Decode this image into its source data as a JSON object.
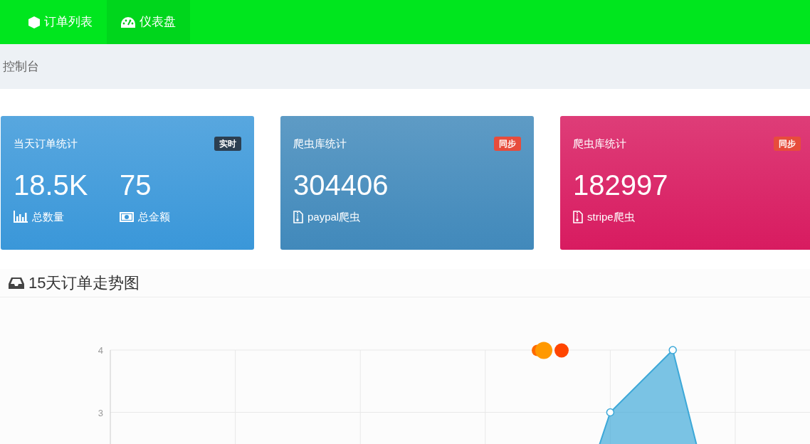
{
  "navbar": {
    "items": [
      {
        "label": "订单列表",
        "kind": "cube",
        "selected": false
      },
      {
        "label": "仪表盘",
        "kind": "gauge",
        "selected": true
      }
    ]
  },
  "breadcrumb": "控制台",
  "cards": [
    {
      "title": "当天订单统计",
      "badge": {
        "text": "实时",
        "color": "#2c3e50"
      },
      "color": "#3a97d9",
      "stats": [
        {
          "value": "18.5K",
          "label": "总数量",
          "kind": "bars"
        },
        {
          "value": "75",
          "label": "总金额",
          "kind": "money"
        }
      ]
    },
    {
      "title": "爬虫库统计",
      "badge": {
        "text": "同步",
        "color": "#e74c3c"
      },
      "color": "#4189bb",
      "stats": [
        {
          "value": "304406",
          "label": "paypal爬虫",
          "kind": "file"
        }
      ]
    },
    {
      "title": "爬虫库统计",
      "badge": {
        "text": "同步",
        "color": "#e74c3c"
      },
      "color": "#d81b60",
      "stats": [
        {
          "value": "182997",
          "label": "stripe爬虫",
          "kind": "file"
        }
      ]
    }
  ],
  "chart": {
    "title": "15天订单走势图",
    "y_axis_labels": [
      "4",
      "3"
    ]
  }
}
